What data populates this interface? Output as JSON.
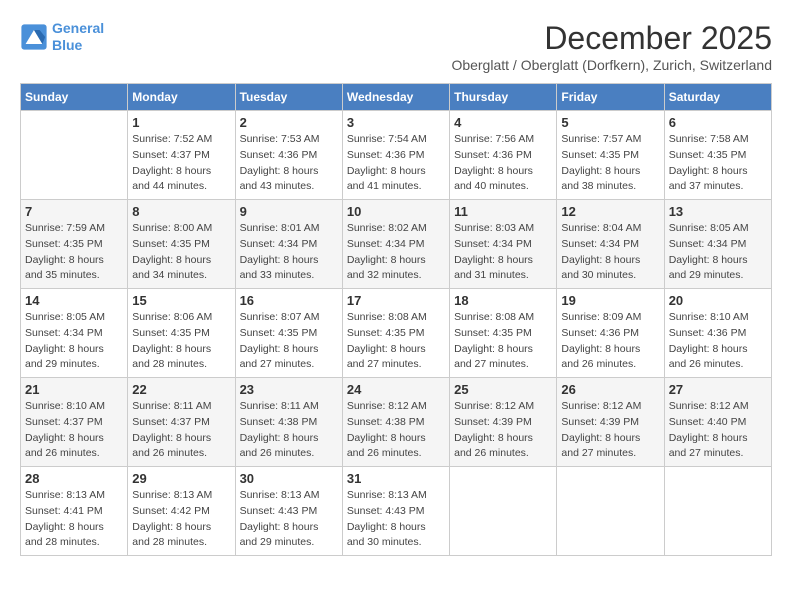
{
  "logo": {
    "line1": "General",
    "line2": "Blue"
  },
  "title": "December 2025",
  "subtitle": "Oberglatt / Oberglatt (Dorfkern), Zurich, Switzerland",
  "days_of_week": [
    "Sunday",
    "Monday",
    "Tuesday",
    "Wednesday",
    "Thursday",
    "Friday",
    "Saturday"
  ],
  "weeks": [
    [
      {
        "day": "",
        "info": ""
      },
      {
        "day": "1",
        "info": "Sunrise: 7:52 AM\nSunset: 4:37 PM\nDaylight: 8 hours\nand 44 minutes."
      },
      {
        "day": "2",
        "info": "Sunrise: 7:53 AM\nSunset: 4:36 PM\nDaylight: 8 hours\nand 43 minutes."
      },
      {
        "day": "3",
        "info": "Sunrise: 7:54 AM\nSunset: 4:36 PM\nDaylight: 8 hours\nand 41 minutes."
      },
      {
        "day": "4",
        "info": "Sunrise: 7:56 AM\nSunset: 4:36 PM\nDaylight: 8 hours\nand 40 minutes."
      },
      {
        "day": "5",
        "info": "Sunrise: 7:57 AM\nSunset: 4:35 PM\nDaylight: 8 hours\nand 38 minutes."
      },
      {
        "day": "6",
        "info": "Sunrise: 7:58 AM\nSunset: 4:35 PM\nDaylight: 8 hours\nand 37 minutes."
      }
    ],
    [
      {
        "day": "7",
        "info": "Sunrise: 7:59 AM\nSunset: 4:35 PM\nDaylight: 8 hours\nand 35 minutes."
      },
      {
        "day": "8",
        "info": "Sunrise: 8:00 AM\nSunset: 4:35 PM\nDaylight: 8 hours\nand 34 minutes."
      },
      {
        "day": "9",
        "info": "Sunrise: 8:01 AM\nSunset: 4:34 PM\nDaylight: 8 hours\nand 33 minutes."
      },
      {
        "day": "10",
        "info": "Sunrise: 8:02 AM\nSunset: 4:34 PM\nDaylight: 8 hours\nand 32 minutes."
      },
      {
        "day": "11",
        "info": "Sunrise: 8:03 AM\nSunset: 4:34 PM\nDaylight: 8 hours\nand 31 minutes."
      },
      {
        "day": "12",
        "info": "Sunrise: 8:04 AM\nSunset: 4:34 PM\nDaylight: 8 hours\nand 30 minutes."
      },
      {
        "day": "13",
        "info": "Sunrise: 8:05 AM\nSunset: 4:34 PM\nDaylight: 8 hours\nand 29 minutes."
      }
    ],
    [
      {
        "day": "14",
        "info": "Sunrise: 8:05 AM\nSunset: 4:34 PM\nDaylight: 8 hours\nand 29 minutes."
      },
      {
        "day": "15",
        "info": "Sunrise: 8:06 AM\nSunset: 4:35 PM\nDaylight: 8 hours\nand 28 minutes."
      },
      {
        "day": "16",
        "info": "Sunrise: 8:07 AM\nSunset: 4:35 PM\nDaylight: 8 hours\nand 27 minutes."
      },
      {
        "day": "17",
        "info": "Sunrise: 8:08 AM\nSunset: 4:35 PM\nDaylight: 8 hours\nand 27 minutes."
      },
      {
        "day": "18",
        "info": "Sunrise: 8:08 AM\nSunset: 4:35 PM\nDaylight: 8 hours\nand 27 minutes."
      },
      {
        "day": "19",
        "info": "Sunrise: 8:09 AM\nSunset: 4:36 PM\nDaylight: 8 hours\nand 26 minutes."
      },
      {
        "day": "20",
        "info": "Sunrise: 8:10 AM\nSunset: 4:36 PM\nDaylight: 8 hours\nand 26 minutes."
      }
    ],
    [
      {
        "day": "21",
        "info": "Sunrise: 8:10 AM\nSunset: 4:37 PM\nDaylight: 8 hours\nand 26 minutes."
      },
      {
        "day": "22",
        "info": "Sunrise: 8:11 AM\nSunset: 4:37 PM\nDaylight: 8 hours\nand 26 minutes."
      },
      {
        "day": "23",
        "info": "Sunrise: 8:11 AM\nSunset: 4:38 PM\nDaylight: 8 hours\nand 26 minutes."
      },
      {
        "day": "24",
        "info": "Sunrise: 8:12 AM\nSunset: 4:38 PM\nDaylight: 8 hours\nand 26 minutes."
      },
      {
        "day": "25",
        "info": "Sunrise: 8:12 AM\nSunset: 4:39 PM\nDaylight: 8 hours\nand 26 minutes."
      },
      {
        "day": "26",
        "info": "Sunrise: 8:12 AM\nSunset: 4:39 PM\nDaylight: 8 hours\nand 27 minutes."
      },
      {
        "day": "27",
        "info": "Sunrise: 8:12 AM\nSunset: 4:40 PM\nDaylight: 8 hours\nand 27 minutes."
      }
    ],
    [
      {
        "day": "28",
        "info": "Sunrise: 8:13 AM\nSunset: 4:41 PM\nDaylight: 8 hours\nand 28 minutes."
      },
      {
        "day": "29",
        "info": "Sunrise: 8:13 AM\nSunset: 4:42 PM\nDaylight: 8 hours\nand 28 minutes."
      },
      {
        "day": "30",
        "info": "Sunrise: 8:13 AM\nSunset: 4:43 PM\nDaylight: 8 hours\nand 29 minutes."
      },
      {
        "day": "31",
        "info": "Sunrise: 8:13 AM\nSunset: 4:43 PM\nDaylight: 8 hours\nand 30 minutes."
      },
      {
        "day": "",
        "info": ""
      },
      {
        "day": "",
        "info": ""
      },
      {
        "day": "",
        "info": ""
      }
    ]
  ]
}
